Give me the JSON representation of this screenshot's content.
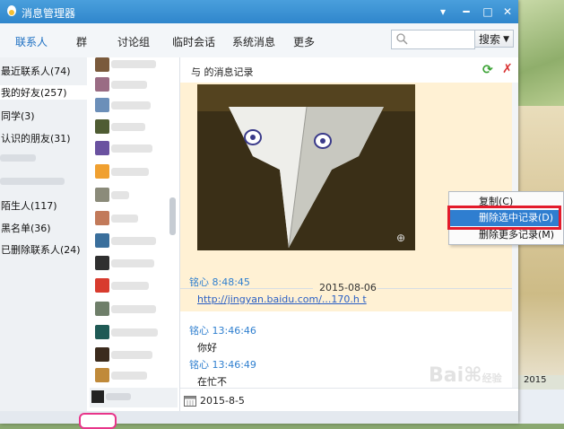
{
  "window": {
    "title": "消息管理器"
  },
  "tabs": [
    {
      "label": "联系人"
    },
    {
      "label": "群"
    },
    {
      "label": "讨论组"
    },
    {
      "label": "临时会话"
    },
    {
      "label": "系统消息"
    },
    {
      "label": "更多"
    }
  ],
  "search": {
    "placeholder": "",
    "button_label": "搜索"
  },
  "groups": [
    {
      "label": "最近联系人(74)"
    },
    {
      "label": "我的好友(257)"
    },
    {
      "label": "同学(3)"
    },
    {
      "label": "认识的朋友(31)"
    },
    {
      "label": "陌生人(117)"
    },
    {
      "label": "黑名单(36)"
    },
    {
      "label": "已删除联系人(24)"
    }
  ],
  "chat": {
    "header": "与          的消息记录",
    "date_separator": "2015-08-06",
    "messages": [
      {
        "sender": "铭心 8:48:45",
        "text": "http://jingyan.baidu.com/...170.h t"
      },
      {
        "sender": "铭心 13:46:46",
        "text": "你好"
      },
      {
        "sender": "铭心 13:46:49",
        "text": "在忙不"
      }
    ],
    "footer_date": "2015-8-5"
  },
  "context_menu": {
    "items": [
      {
        "label": "复制(C)"
      },
      {
        "label": "删除选中记录(D)"
      },
      {
        "label": "删除更多记录(M)"
      }
    ]
  },
  "background_app": {
    "date": "2015"
  },
  "colors": {
    "accent": "#2f86cc",
    "highlight": "#2f7ed0",
    "annotation": "#e31b2b"
  }
}
